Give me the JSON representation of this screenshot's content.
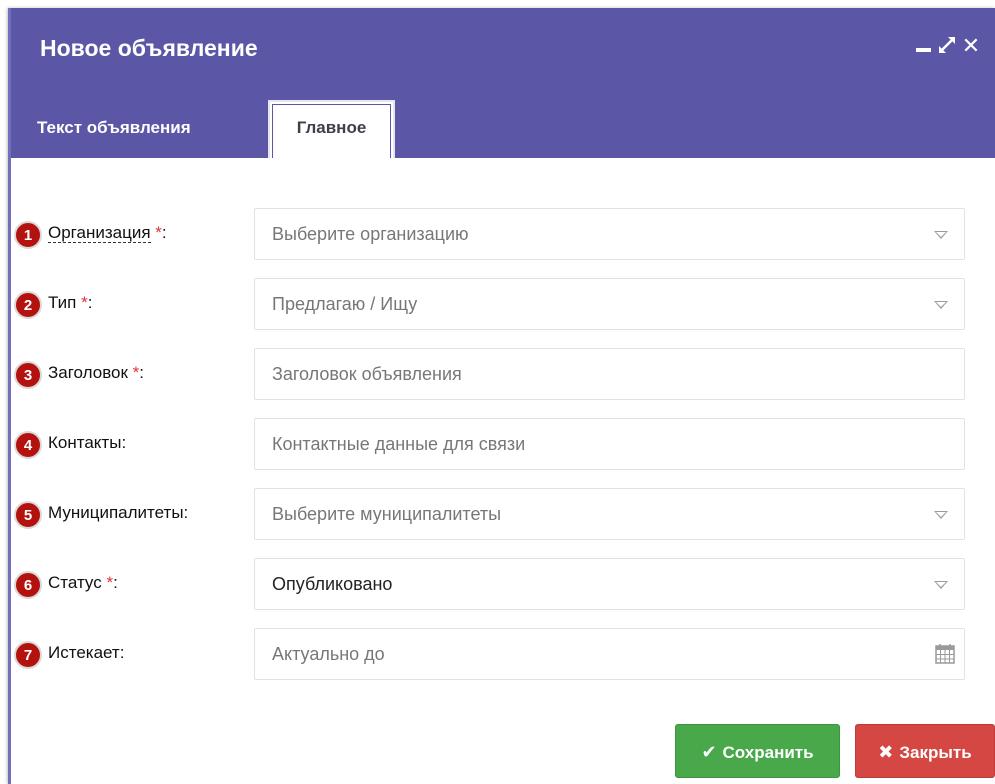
{
  "window": {
    "title": "Новое объявление",
    "controls": {
      "minimize": "minimize-icon",
      "maximize": "maximize-icon",
      "close": "close-icon"
    }
  },
  "tabs": [
    {
      "label": "Текст объявления",
      "active": false
    },
    {
      "label": "Главное",
      "active": true
    }
  ],
  "required_mark": "*",
  "fields": [
    {
      "number": "1",
      "label": "Организация",
      "required": true,
      "type": "select",
      "placeholder": "Выберите организацию"
    },
    {
      "number": "2",
      "label": "Тип",
      "required": true,
      "type": "select",
      "placeholder": "Предлагаю / Ищу"
    },
    {
      "number": "3",
      "label": "Заголовок",
      "required": true,
      "type": "text",
      "placeholder": "Заголовок объявления"
    },
    {
      "number": "4",
      "label": "Контакты",
      "required": false,
      "type": "text",
      "placeholder": "Контактные данные для связи"
    },
    {
      "number": "5",
      "label": "Муниципалитеты",
      "required": false,
      "type": "select",
      "placeholder": "Выберите муниципалитеты"
    },
    {
      "number": "6",
      "label": "Статус",
      "required": true,
      "type": "select",
      "value": "Опубликовано"
    },
    {
      "number": "7",
      "label": "Истекает",
      "required": false,
      "type": "date",
      "placeholder": "Актуально до"
    }
  ],
  "buttons": {
    "save": {
      "label": "Сохранить",
      "icon": "check-icon",
      "color": "#48a84a"
    },
    "close": {
      "label": "Закрыть",
      "icon": "x-icon",
      "color": "#d44743"
    }
  },
  "colors": {
    "header": "#5b56a6",
    "badge": "#b3120f",
    "required": "#dd3333"
  }
}
